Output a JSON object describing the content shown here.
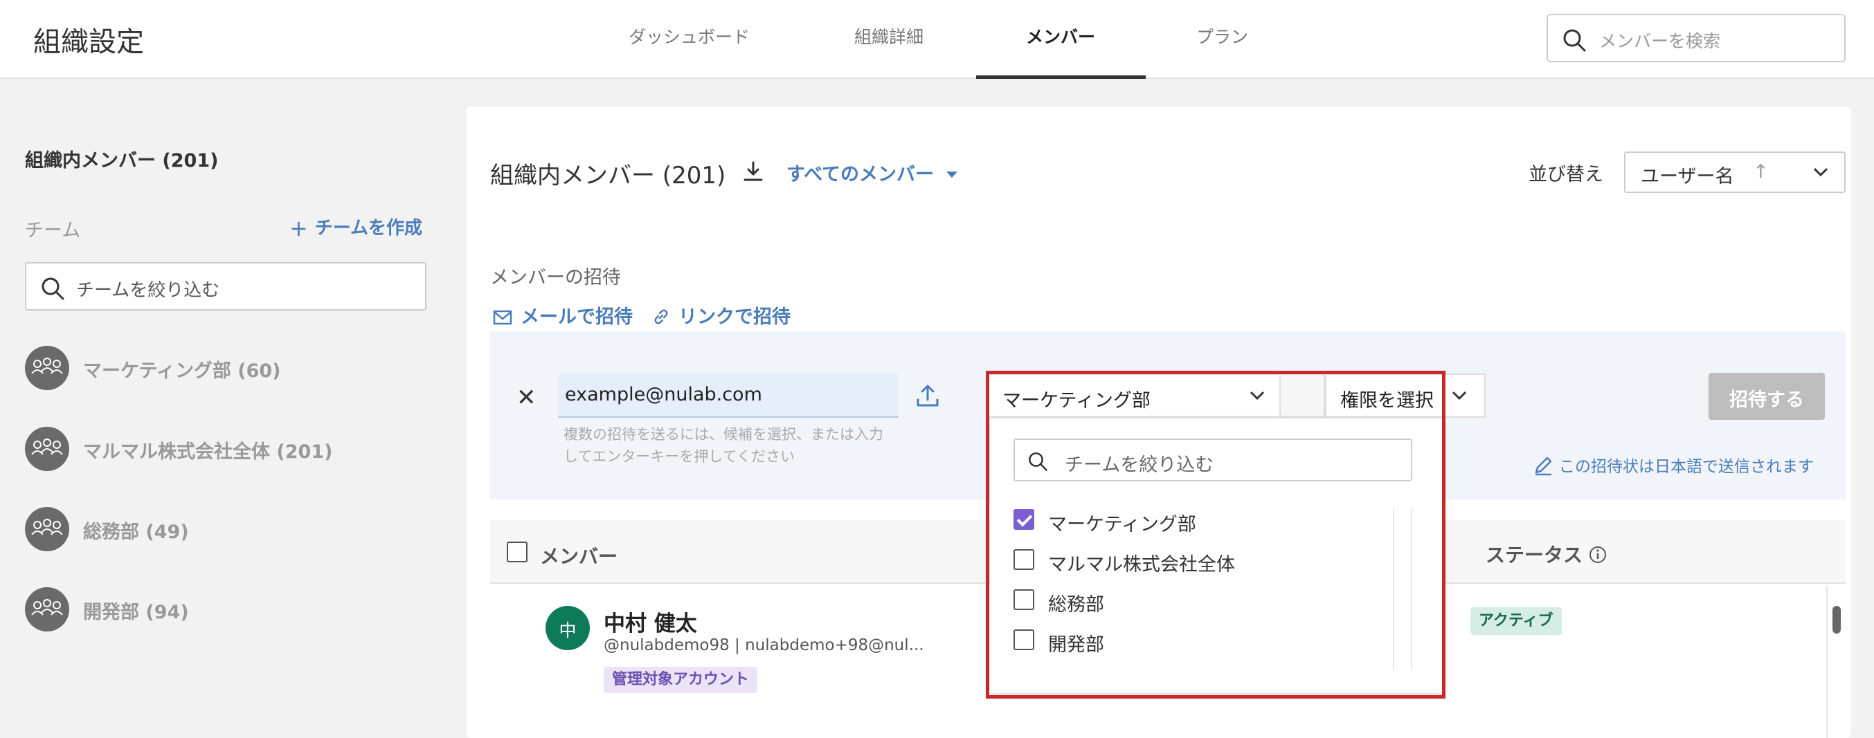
{
  "header": {
    "title": "組織設定",
    "tabs": [
      {
        "label": "ダッシュボード",
        "active": false
      },
      {
        "label": "組織詳細",
        "active": false
      },
      {
        "label": "メンバー",
        "active": true
      },
      {
        "label": "プラン",
        "active": false
      }
    ],
    "search": {
      "placeholder": "メンバーを検索",
      "icon": "search-icon"
    }
  },
  "sidebar": {
    "title": "組織内メンバー (201)",
    "team_label": "チーム",
    "create_team": "チームを作成",
    "filter_placeholder": "チームを絞り込む",
    "teams": [
      {
        "name": "マーケティング部 (60)",
        "icon": "team-icon"
      },
      {
        "name": "マルマル株式会社全体 (201)",
        "icon": "team-icon"
      },
      {
        "name": "総務部 (49)",
        "icon": "team-icon"
      },
      {
        "name": "開発部 (94)",
        "icon": "team-icon"
      }
    ]
  },
  "main": {
    "title": "組織内メンバー (201)",
    "filter": "すべてのメンバー",
    "sort": {
      "label": "並び替え",
      "value": "ユーザー名",
      "direction": "↑"
    },
    "invite": {
      "section_label": "メンバーの招待",
      "by_mail": "メールで招待",
      "by_link": "リンクで招待",
      "email_value": "example@nulab.com",
      "hint_line1": "複数の招待を送るには、候補を選択、または入力",
      "hint_line2": "してエンターキーを押してください",
      "team_value": "マーケティング部",
      "role_value": "権限を選択",
      "submit": "招待する",
      "language_note": "この招待状は日本語で送信されます"
    },
    "table": {
      "col_member": "メンバー",
      "col_status": "ステータス",
      "rows": [
        {
          "avatar": "中",
          "name": "中村 健太",
          "handle": "@nulabdemo98 | nulabdemo+98@nul...",
          "badge": "管理対象アカウント",
          "status": "アクティブ"
        }
      ]
    }
  },
  "team_dropdown": {
    "filter_placeholder": "チームを絞り込む",
    "options": [
      {
        "label": "マーケティング部",
        "checked": true
      },
      {
        "label": "マルマル株式会社全体",
        "checked": false
      },
      {
        "label": "総務部",
        "checked": false
      },
      {
        "label": "開発部",
        "checked": false
      }
    ]
  },
  "colors": {
    "accent": "#4a7cb9",
    "checkbox_checked": "#7b5ecf",
    "avatar": "#0f7a5a",
    "highlight": "#c9272b",
    "status_active": "#17694c"
  }
}
